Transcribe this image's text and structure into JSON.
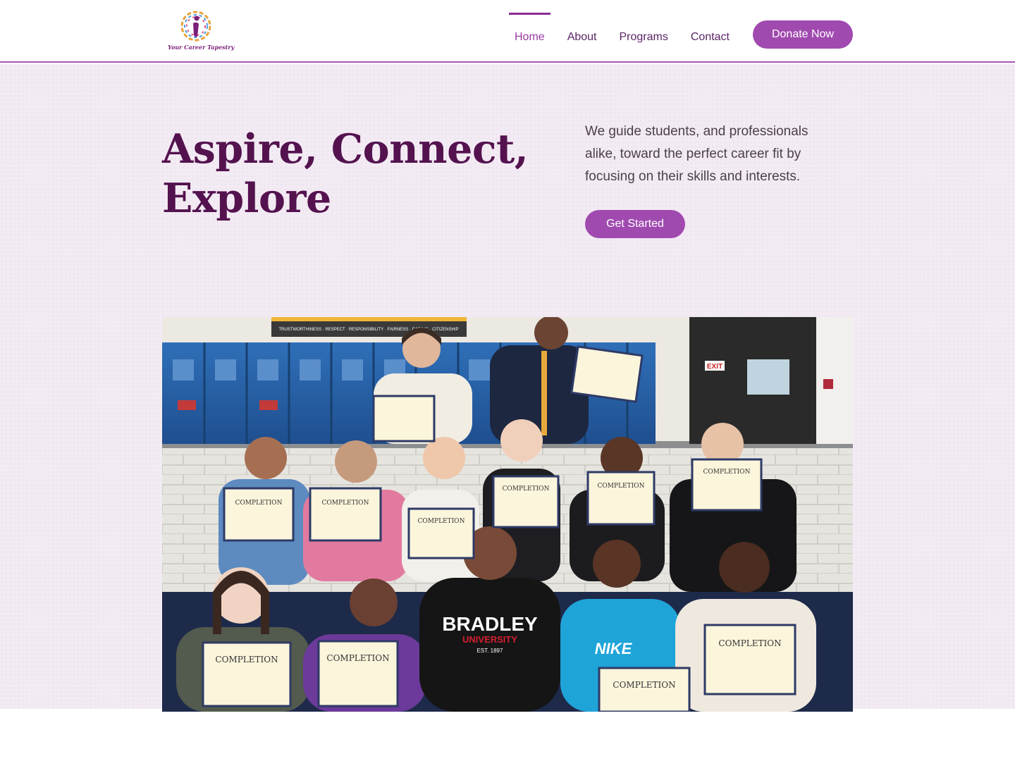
{
  "brand": {
    "logo_text": "Your Career Tapestry",
    "colors": {
      "primary": "#a04aaf",
      "heading": "#54124f",
      "nav_active": "#9a3aa6"
    }
  },
  "nav": {
    "items": [
      {
        "label": "Home",
        "active": true
      },
      {
        "label": "About",
        "active": false
      },
      {
        "label": "Programs",
        "active": false
      },
      {
        "label": "Contact",
        "active": false
      }
    ],
    "donate_label": "Donate Now"
  },
  "hero": {
    "title_line1": "Aspire, Connect,",
    "title_line2": "Explore",
    "description": "We guide students, and professionals alike, toward the perfect career fit by focusing on their skills and interests.",
    "cta_label": "Get Started"
  },
  "photo": {
    "banner_text": "TRUSTWORTHINESS · RESPECT · RESPONSIBILITY · FAIRNESS · CARING · CITIZENSHIP",
    "exit_sign": "EXIT",
    "certificate_label": "COMPLETION",
    "shirt_text_1": "BRADLEY",
    "shirt_text_2": "UNIVERSITY",
    "shirt_text_3": "EST. 1897",
    "shirt_text_4": "NIKE"
  }
}
